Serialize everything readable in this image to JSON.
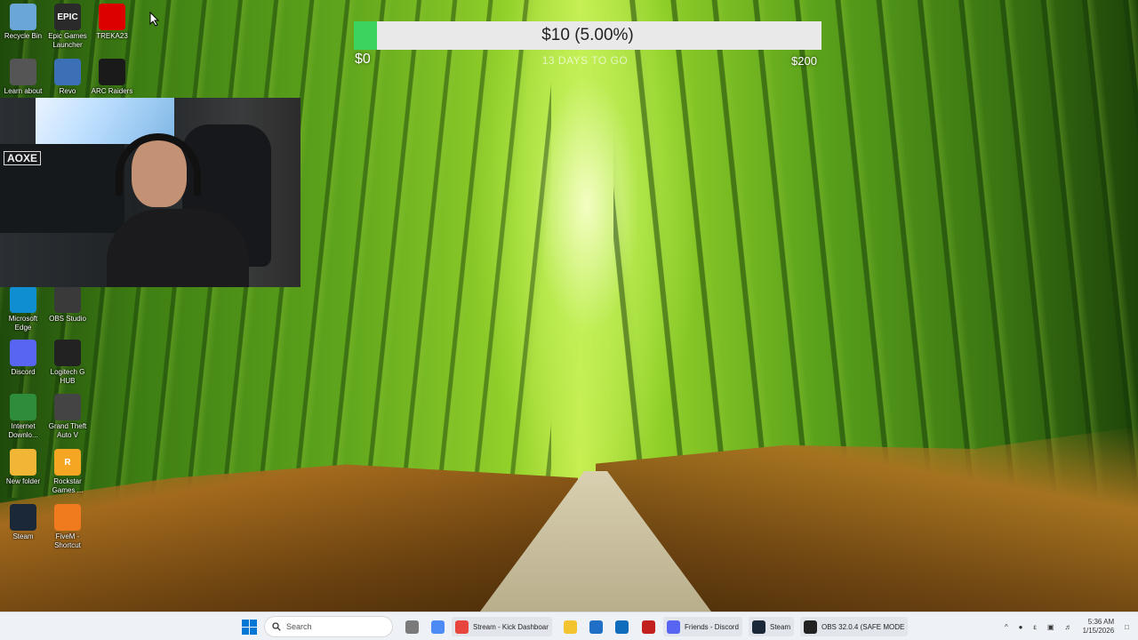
{
  "goal": {
    "text": "$10 (5.00%)",
    "min": "$0",
    "max": "$200",
    "days_left": "13 DAYS TO GO",
    "progress_fraction": 0.05,
    "fill_color": "#3dd35f"
  },
  "desktop_icons": [
    {
      "label": "Recycle Bin",
      "icon": "recycle-bin-icon",
      "color": "#6aa7d8"
    },
    {
      "label": "Epic Games Launcher",
      "icon": "epic-games-icon",
      "color": "#2a2a2a",
      "text": "EPIC"
    },
    {
      "label": "TREKA23",
      "icon": "german-flag-icon",
      "color": "#dd0000"
    },
    {
      "label": "Learn about",
      "icon": "learn-about-icon",
      "color": "#555555"
    },
    {
      "label": "Revo",
      "icon": "revo-icon",
      "color": "#3b6fb6"
    },
    {
      "label": "ARC Raiders",
      "icon": "arc-raiders-icon",
      "color": "#1a1a1a"
    },
    {
      "label": "Microsoft Edge",
      "icon": "edge-icon",
      "color": "#0f8fd1"
    },
    {
      "label": "OBS Studio",
      "icon": "obs-icon",
      "color": "#3a3a3a"
    },
    {
      "label": "Discord",
      "icon": "discord-icon",
      "color": "#5865f2"
    },
    {
      "label": "Logitech G HUB",
      "icon": "logitech-icon",
      "color": "#222222"
    },
    {
      "label": "Internet Downlo...",
      "icon": "idm-icon",
      "color": "#2d8d3a"
    },
    {
      "label": "Grand Theft Auto V",
      "icon": "gta-icon",
      "color": "#444444"
    },
    {
      "label": "New folder",
      "icon": "folder-icon",
      "color": "#f2b636"
    },
    {
      "label": "Rockstar Games ...",
      "icon": "rockstar-icon",
      "color": "#f5a623",
      "text": "R"
    },
    {
      "label": "Steam",
      "icon": "steam-icon",
      "color": "#1b2838"
    },
    {
      "label": "FiveM - Shortcut",
      "icon": "fivem-icon",
      "color": "#f07b1e"
    }
  ],
  "webcam": {
    "logo": "AOXE"
  },
  "taskbar": {
    "search_placeholder": "Search",
    "apps": [
      {
        "label": "",
        "icon": "store-icon",
        "color": "#7a7a7a"
      },
      {
        "label": "",
        "icon": "copilot-icon",
        "color": "#4c8bf5"
      },
      {
        "label": "Stream - Kick Dashboar",
        "icon": "chrome-icon",
        "color": "#e8453c"
      },
      {
        "label": "",
        "icon": "file-explorer-icon",
        "color": "#f4c430"
      },
      {
        "label": "",
        "icon": "calendar-icon",
        "color": "#1f6fc7"
      },
      {
        "label": "",
        "icon": "outlook-icon",
        "color": "#0f6cbd"
      },
      {
        "label": "",
        "icon": "app-red-icon",
        "color": "#c21f1f"
      },
      {
        "label": "Friends - Discord",
        "icon": "discord-taskbar-icon",
        "color": "#5865f2"
      },
      {
        "label": "Steam",
        "icon": "steam-taskbar-icon",
        "color": "#1b2838"
      },
      {
        "label": "OBS 32.0.4 (SAFE MODE",
        "icon": "obs-taskbar-icon",
        "color": "#222222"
      }
    ],
    "tray": {
      "time": "5:36 AM",
      "date": "1/15/2026"
    }
  }
}
